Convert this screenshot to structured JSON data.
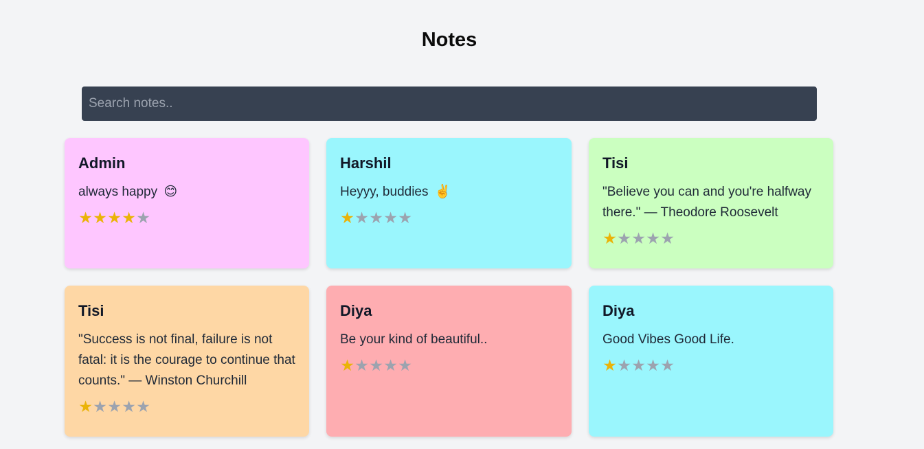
{
  "header": {
    "title": "Notes"
  },
  "search": {
    "placeholder": "Search notes.."
  },
  "colors": {
    "pink": "#fec6ff",
    "cyan": "#9af6fd",
    "green": "#cbffc0",
    "orange": "#fed7a5",
    "red": "#feadb1",
    "star_on": "#eab308",
    "star_off": "#9ca3af"
  },
  "notes": [
    {
      "author": "Admin",
      "text": "always happy",
      "emoji": "😊",
      "rating": 4,
      "color": "#fec6ff"
    },
    {
      "author": "Harshil",
      "text": "Heyyy, buddies",
      "emoji": "✌️",
      "rating": 1,
      "color": "#9af6fd"
    },
    {
      "author": "Tisi",
      "text": "\"Believe you can and you're halfway there.\" — Theodore Roosevelt",
      "emoji": "",
      "rating": 1,
      "color": "#cbffc0"
    },
    {
      "author": "Tisi",
      "text": "\"Success is not final, failure is not fatal: it is the courage to continue that counts.\" — Winston Churchill",
      "emoji": "",
      "rating": 1,
      "color": "#fed7a5"
    },
    {
      "author": "Diya",
      "text": "Be your kind of beautiful..",
      "emoji": "",
      "rating": 1,
      "color": "#feadb1"
    },
    {
      "author": "Diya",
      "text": "Good Vibes Good Life.",
      "emoji": "",
      "rating": 1,
      "color": "#9af6fd"
    }
  ]
}
